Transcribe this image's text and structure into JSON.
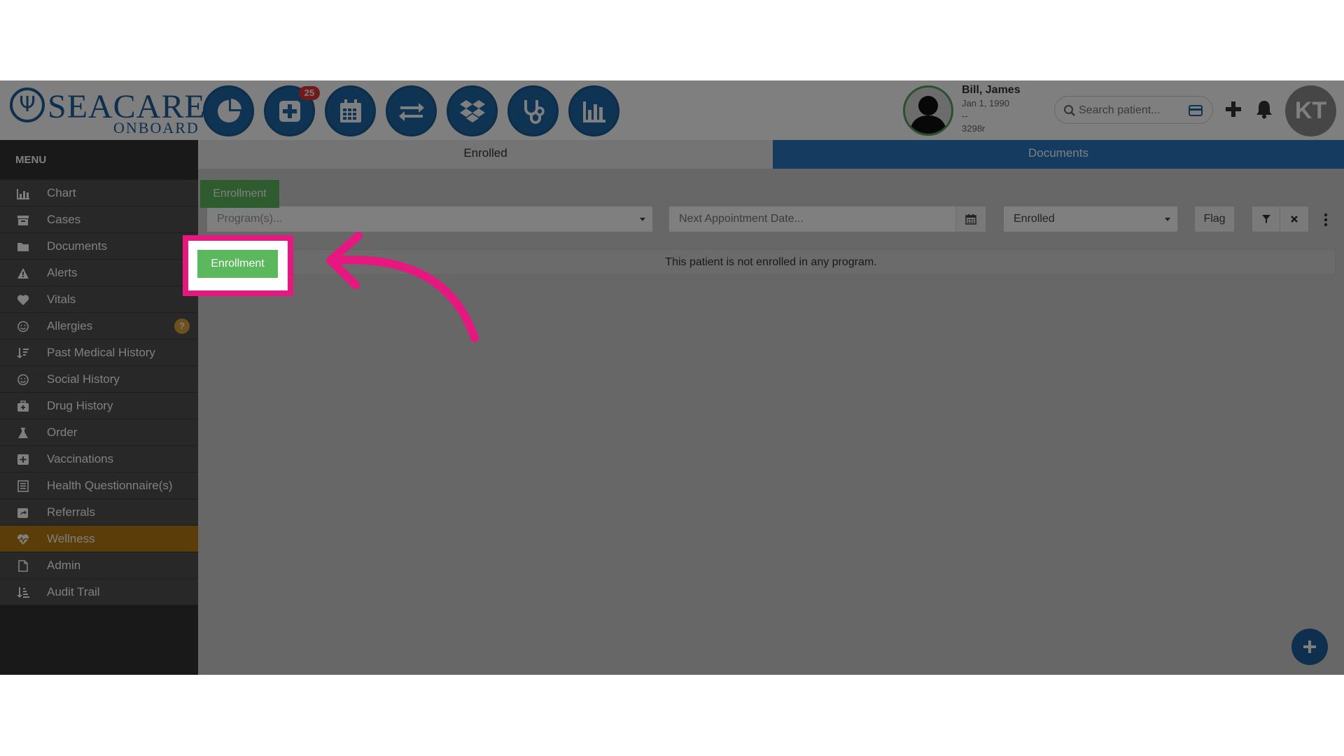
{
  "header": {
    "logo_main": "SEACARE",
    "logo_sub": "ONBOARD",
    "nav": [
      {
        "name": "dashboard",
        "icon": "pie-chart-icon"
      },
      {
        "name": "add-record",
        "icon": "plus-square-icon",
        "badge": "25"
      },
      {
        "name": "calendar",
        "icon": "calendar-icon"
      },
      {
        "name": "transfer",
        "icon": "exchange-icon"
      },
      {
        "name": "dropbox",
        "icon": "dropbox-icon"
      },
      {
        "name": "clinical",
        "icon": "stethoscope-icon"
      },
      {
        "name": "reports",
        "icon": "bar-chart-icon"
      }
    ],
    "patient": {
      "name": "Bill, James",
      "dob": "Jan 1, 1990",
      "extra": "--",
      "id": "3298r"
    },
    "search_placeholder": "Search patient...",
    "user_initials": "KT"
  },
  "sidebar": {
    "title": "MENU",
    "items": [
      {
        "label": "Chart",
        "icon": "bar-chart-icon"
      },
      {
        "label": "Cases",
        "icon": "folder-box-icon"
      },
      {
        "label": "Documents",
        "icon": "folder-icon"
      },
      {
        "label": "Alerts",
        "icon": "warning-icon"
      },
      {
        "label": "Vitals",
        "icon": "heart-icon"
      },
      {
        "label": "Allergies",
        "icon": "smile-icon",
        "badge": "?"
      },
      {
        "label": "Past Medical History",
        "icon": "sort-list-icon"
      },
      {
        "label": "Social History",
        "icon": "smile-icon"
      },
      {
        "label": "Drug History",
        "icon": "medkit-icon"
      },
      {
        "label": "Order",
        "icon": "flask-icon"
      },
      {
        "label": "Vaccinations",
        "icon": "plus-square-icon"
      },
      {
        "label": "Health Questionnaire(s)",
        "icon": "list-doc-icon"
      },
      {
        "label": "Referrals",
        "icon": "share-square-icon"
      },
      {
        "label": "Wellness",
        "icon": "heartbeat-icon",
        "active": true
      },
      {
        "label": "Admin",
        "icon": "file-icon"
      },
      {
        "label": "Audit Trail",
        "icon": "sort-amount-icon"
      }
    ]
  },
  "main": {
    "tabs": [
      {
        "label": "Enrolled",
        "active": true
      },
      {
        "label": "Documents",
        "active": false
      }
    ],
    "enroll_button": "Enrollment",
    "filters": {
      "program_placeholder": "Program(s)...",
      "date_placeholder": "Next Appointment Date...",
      "status_value": "Enrolled",
      "flag_label": "Flag"
    },
    "empty_message": "This patient is not enrolled in any program."
  },
  "colors": {
    "brand_blue": "#1f66a7",
    "tab_blue": "#2879c1",
    "enroll_green": "#5cb85c",
    "active_menu": "#b47a13",
    "highlight_magenta": "#e6177e"
  }
}
